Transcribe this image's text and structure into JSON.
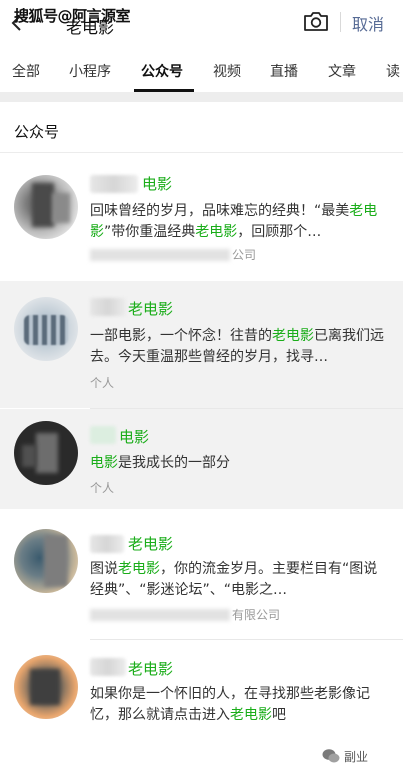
{
  "topbar": {
    "watermark": "搜狐号@阿言源室",
    "search_query": "老电影",
    "cancel_label": "取消",
    "icons": [
      "back-icon",
      "camera-icon"
    ]
  },
  "tabs": [
    "全部",
    "小程序",
    "公众号",
    "视频",
    "直播",
    "文章",
    "读"
  ],
  "active_tab": "公众号",
  "section_title": "公众号",
  "results": [
    {
      "name": "电影",
      "desc_parts": [
        {
          "t": "回味曾经的岁月，品味难忘的经典！“最美",
          "h": false
        },
        {
          "t": "老电影",
          "h": true
        },
        {
          "t": "”带你重温经典",
          "h": false
        },
        {
          "t": "老电影",
          "h": true
        },
        {
          "t": "，回顾那个…",
          "h": false
        }
      ],
      "meta": "公司"
    },
    {
      "name": "老电影",
      "desc_parts": [
        {
          "t": "一部电影，一个怀念！往昔的",
          "h": false
        },
        {
          "t": "老电影",
          "h": true
        },
        {
          "t": "已离我们远去。今天重温那些曾经的岁月，找寻…",
          "h": false
        }
      ],
      "meta": "个人"
    },
    {
      "name": "电影",
      "desc_parts": [
        {
          "t": "电影",
          "h": true
        },
        {
          "t": "是我成长的一部分",
          "h": false
        }
      ],
      "meta": "个人"
    },
    {
      "name": "老电影",
      "desc_parts": [
        {
          "t": "图说",
          "h": false
        },
        {
          "t": "老电影",
          "h": true
        },
        {
          "t": "，你的流金岁月。主要栏目有“图说经典”、“影迷论坛”、“电影之…",
          "h": false
        }
      ],
      "meta": "有限公司"
    },
    {
      "name": "老电影",
      "desc_parts": [
        {
          "t": "如果你是一个怀旧的人，在寻找那些老影像记忆，那么就请点击进入",
          "h": false
        },
        {
          "t": "老电影",
          "h": true
        },
        {
          "t": "吧",
          "h": false
        }
      ],
      "meta": ""
    }
  ],
  "corner_brand": "副业",
  "colors": {
    "highlight": "#1aad19",
    "cancel": "#576b95"
  }
}
